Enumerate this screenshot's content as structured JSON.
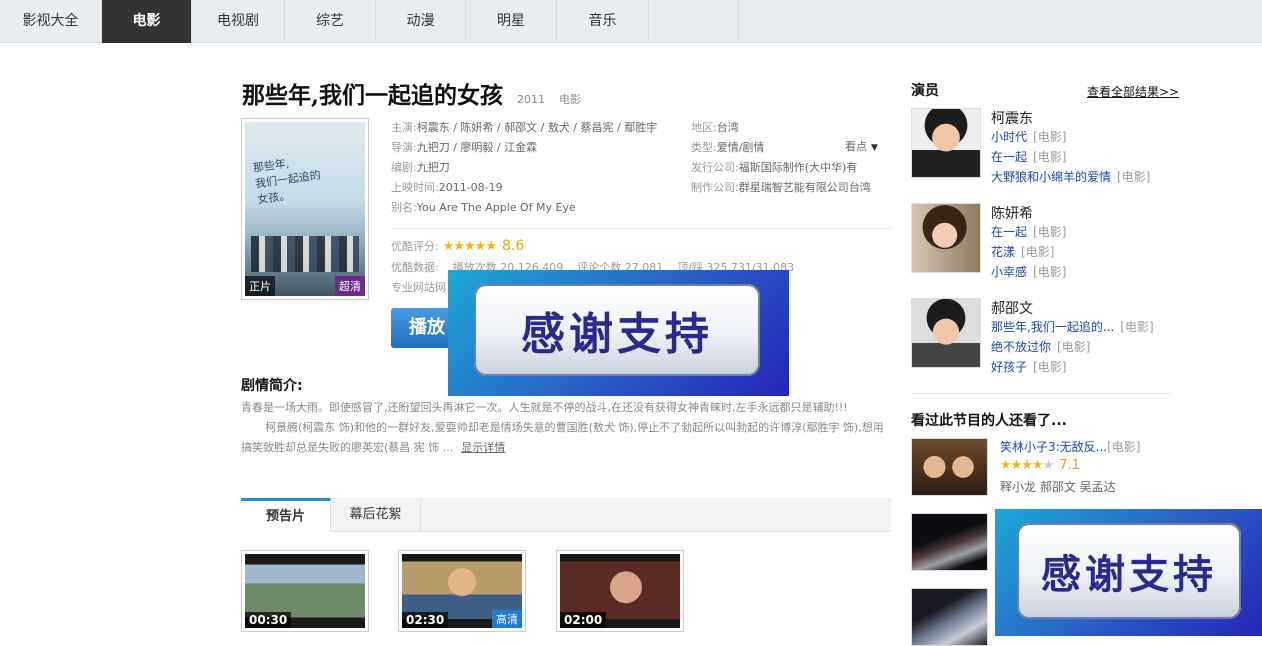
{
  "nav": {
    "tabs": [
      "影视大全",
      "电影",
      "电视剧",
      "综艺",
      "动漫",
      "明星",
      "音乐"
    ],
    "active": "电影"
  },
  "movie": {
    "title": "那些年,我们一起追的女孩",
    "year": "2011",
    "category": "电影",
    "poster": {
      "handwriting_1": "那些年,",
      "handwriting_2": "我们一起追的",
      "handwriting_3": "女孩。",
      "tag_left": "正片",
      "tag_right": "超清"
    },
    "cast_label": "主演:",
    "cast": "柯震东 / 陈妍希 / 郝邵文 / 敖犬 / 蔡昌宪 / 鄢胜宇",
    "director_label": "导演:",
    "director": "九把刀 / 廖明毅 / 江金霖",
    "writer_label": "编剧:",
    "writer": "九把刀",
    "release_label": "上映时间:",
    "release": "2011-08-19",
    "alias_label": "别名:",
    "alias": "You Are The Apple Of My Eye",
    "region_label": "地区:",
    "region": "台湾",
    "genre_label": "类型:",
    "genre": "爱情/剧情",
    "publisher_label": "发行公司:",
    "publisher": "福斯国际制作(大中华)有",
    "producer_label": "制作公司:",
    "producer": "群星瑞智艺能有限公司台湾",
    "watch_label": "看点",
    "rating_label": "优酷评分:",
    "rating_value": 8.6,
    "rating_text": "8.6",
    "stats_label": "优酷数据:",
    "plays": "播放次数 20,126,409",
    "comments": "评论个数 27,081",
    "votes": "顶/踩 325,731/31,083",
    "sites_label": "专业网站网",
    "play_label": "播放"
  },
  "overlay": {
    "text": "感谢支持"
  },
  "synopsis": {
    "title": "剧情简介:",
    "p1": "青春是一场大雨。即使感冒了,还盼望回头再淋它一次。人生就是不停的战斗,在还没有获得女神青睐时,左手永远都只是辅助!!!",
    "p2": "柯景腾(柯震东 饰)和他的一群好友,爱耍帅却老是情场失意的曹国胜(敖犬 饰),停止不了勃起所以叫勃起的许博淳(鄢胜宇 饰),想用搞笑致胜却总是失败的廖英宏(蔡昌 宪 饰 ...",
    "more": "显示详情"
  },
  "trailers": {
    "tabs": [
      "预告片",
      "幕后花絮"
    ],
    "items": [
      {
        "duration": "00:30",
        "badge": ""
      },
      {
        "duration": "02:30",
        "badge": "高清"
      },
      {
        "duration": "02:00",
        "badge": ""
      }
    ]
  },
  "actors": {
    "heading": "演员",
    "view_all": "查看全部结果>>",
    "list": [
      {
        "name": "柯震东",
        "works": [
          {
            "title": "小时代",
            "kind": "[电影]"
          },
          {
            "title": "在一起",
            "kind": "[电影]"
          },
          {
            "title": "大野狼和小绵羊的爱情",
            "kind": "[电影]"
          }
        ]
      },
      {
        "name": "陈妍希",
        "works": [
          {
            "title": "在一起",
            "kind": "[电影]"
          },
          {
            "title": "花漾",
            "kind": "[电影]"
          },
          {
            "title": "小幸感",
            "kind": "[电影]"
          }
        ]
      },
      {
        "name": "郝邵文",
        "works": [
          {
            "title": "那些年,我们一起追的...",
            "kind": "[电影]"
          },
          {
            "title": "绝不放过你",
            "kind": "[电影]"
          },
          {
            "title": "好孩子",
            "kind": "[电影]"
          }
        ]
      }
    ]
  },
  "recommend": {
    "heading": "看过此节目的人还看了...",
    "items": [
      {
        "title": "笑林小子3:无敌反...",
        "kind": "[电影]",
        "rating": 7.1,
        "rating_text": "7.1",
        "cast": "释小龙 郝邵文 吴孟达"
      }
    ]
  },
  "colors": {
    "accent": "#1e8fd6",
    "link": "#1a47a8",
    "star": "#f3b512",
    "nav_active": "#333333"
  }
}
